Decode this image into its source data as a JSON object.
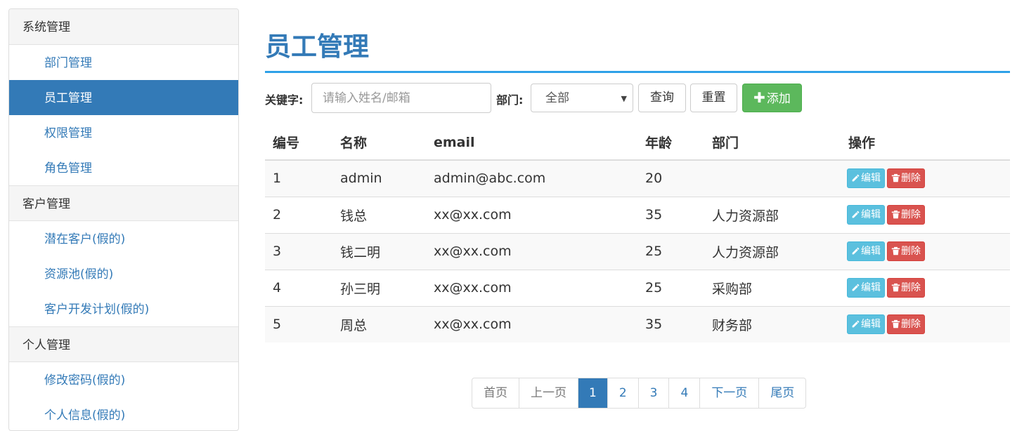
{
  "sidebar": {
    "groups": [
      {
        "header": "系统管理",
        "items": [
          "部门管理",
          "员工管理",
          "权限管理",
          "角色管理"
        ]
      },
      {
        "header": "客户管理",
        "items": [
          "潜在客户(假的)",
          "资源池(假的)",
          "客户开发计划(假的)"
        ]
      },
      {
        "header": "个人管理",
        "items": [
          "修改密码(假的)",
          "个人信息(假的)"
        ]
      }
    ],
    "active_item": "员工管理"
  },
  "main": {
    "title": "员工管理",
    "search": {
      "keyword_label": "关键字:",
      "keyword_placeholder": "请输入姓名/邮箱",
      "keyword_value": "",
      "dept_label": "部门:",
      "dept_selected": "全部",
      "query_button": "查询",
      "reset_button": "重置",
      "add_button": "添加"
    },
    "table": {
      "columns": [
        "编号",
        "名称",
        "email",
        "年龄",
        "部门",
        "操作"
      ],
      "rows": [
        {
          "id": "1",
          "name": "admin",
          "email": "admin@abc.com",
          "age": "20",
          "dept": ""
        },
        {
          "id": "2",
          "name": "钱总",
          "email": "xx@xx.com",
          "age": "35",
          "dept": "人力资源部"
        },
        {
          "id": "3",
          "name": "钱二明",
          "email": "xx@xx.com",
          "age": "25",
          "dept": "人力资源部"
        },
        {
          "id": "4",
          "name": "孙三明",
          "email": "xx@xx.com",
          "age": "25",
          "dept": "采购部"
        },
        {
          "id": "5",
          "name": "周总",
          "email": "xx@xx.com",
          "age": "35",
          "dept": "财务部"
        }
      ],
      "edit_label": "编辑",
      "delete_label": "删除"
    },
    "pagination": {
      "first": "首页",
      "prev": "上一页",
      "pages": [
        "1",
        "2",
        "3",
        "4"
      ],
      "current": "1",
      "next": "下一页",
      "last": "尾页"
    }
  },
  "colors": {
    "primary": "#337ab7",
    "title_rule": "#2ea1e8",
    "success": "#5cb85c",
    "info": "#5bc0de",
    "danger": "#d9534f"
  },
  "icons": {
    "edit": "pencil-icon",
    "delete": "trash-icon",
    "add": "plus-icon",
    "select": "caret-down-icon"
  }
}
